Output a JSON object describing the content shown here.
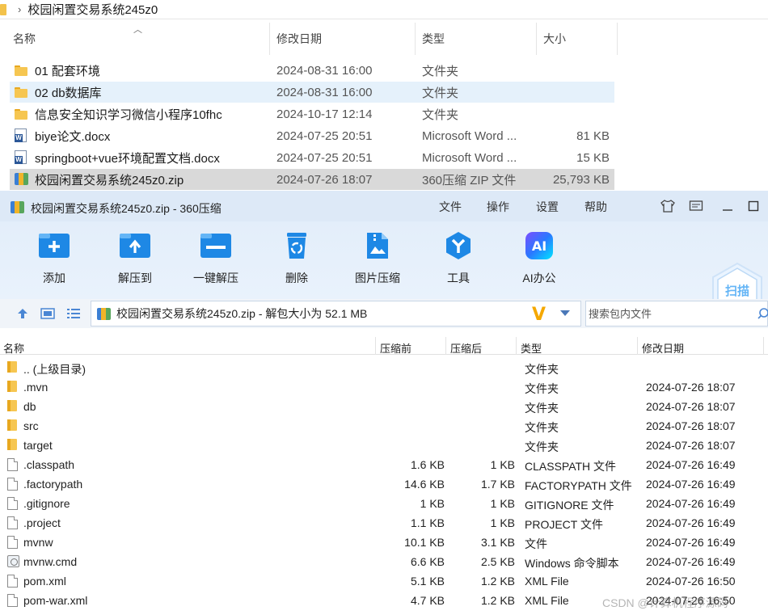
{
  "explorer": {
    "breadcrumb": "校园闲置交易系统245z0",
    "columns": {
      "name": "名称",
      "date": "修改日期",
      "type": "类型",
      "size": "大小"
    },
    "rows": [
      {
        "name": "01 配套环境",
        "date": "2024-08-31 16:00",
        "type": "文件夹",
        "size": "",
        "icon": "folder-icon"
      },
      {
        "name": "02 db数据库",
        "date": "2024-08-31 16:00",
        "type": "文件夹",
        "size": "",
        "icon": "folder-icon"
      },
      {
        "name": "信息安全知识学习微信小程序10fhc",
        "date": "2024-10-17 12:14",
        "type": "文件夹",
        "size": "",
        "icon": "folder-icon"
      },
      {
        "name": "biye论文.docx",
        "date": "2024-07-25 20:51",
        "type": "Microsoft Word ...",
        "size": "81 KB",
        "icon": "word-document-icon"
      },
      {
        "name": "springboot+vue环境配置文档.docx",
        "date": "2024-07-25 20:51",
        "type": "Microsoft Word ...",
        "size": "15 KB",
        "icon": "word-document-icon"
      },
      {
        "name": "校园闲置交易系统245z0.zip",
        "date": "2024-07-26 18:07",
        "type": "360压缩 ZIP 文件",
        "size": "25,793 KB",
        "icon": "zip-archive-icon"
      }
    ]
  },
  "zip_window": {
    "title": "校园闲置交易系统245z0.zip - 360压缩",
    "menu": [
      "文件",
      "操作",
      "设置",
      "帮助"
    ],
    "toolbar": [
      {
        "label": "添加",
        "icon": "add-icon"
      },
      {
        "label": "解压到",
        "icon": "extract-to-icon"
      },
      {
        "label": "一键解压",
        "icon": "one-click-extract-icon"
      },
      {
        "label": "删除",
        "icon": "recycle-bin-icon"
      },
      {
        "label": "图片压缩",
        "icon": "image-compress-icon"
      },
      {
        "label": "工具",
        "icon": "tools-icon"
      },
      {
        "label": "AI办公",
        "icon": "ai-office-icon"
      }
    ],
    "scan_label": "扫描",
    "ai_badge": "AI",
    "address": "校园闲置交易系统245z0.zip - 解包大小为 52.1 MB",
    "search_placeholder": "搜索包内文件",
    "list_columns": {
      "name": "名称",
      "before": "压缩前",
      "after": "压缩后",
      "type": "类型",
      "date": "修改日期"
    },
    "rows": [
      {
        "name": ".. (上级目录)",
        "before": "",
        "after": "",
        "type": "文件夹",
        "date": "",
        "icon": "folder-icon"
      },
      {
        "name": ".mvn",
        "before": "",
        "after": "",
        "type": "文件夹",
        "date": "2024-07-26 18:07",
        "icon": "folder-icon"
      },
      {
        "name": "db",
        "before": "",
        "after": "",
        "type": "文件夹",
        "date": "2024-07-26 18:07",
        "icon": "folder-icon"
      },
      {
        "name": "src",
        "before": "",
        "after": "",
        "type": "文件夹",
        "date": "2024-07-26 18:07",
        "icon": "folder-icon"
      },
      {
        "name": "target",
        "before": "",
        "after": "",
        "type": "文件夹",
        "date": "2024-07-26 18:07",
        "icon": "folder-icon"
      },
      {
        "name": ".classpath",
        "before": "1.6 KB",
        "after": "1 KB",
        "type": "CLASSPATH 文件",
        "date": "2024-07-26 16:49",
        "icon": "file-icon"
      },
      {
        "name": ".factorypath",
        "before": "14.6 KB",
        "after": "1.7 KB",
        "type": "FACTORYPATH 文件",
        "date": "2024-07-26 16:49",
        "icon": "file-icon"
      },
      {
        "name": ".gitignore",
        "before": "1 KB",
        "after": "1 KB",
        "type": "GITIGNORE 文件",
        "date": "2024-07-26 16:49",
        "icon": "file-icon"
      },
      {
        "name": ".project",
        "before": "1.1 KB",
        "after": "1 KB",
        "type": "PROJECT 文件",
        "date": "2024-07-26 16:49",
        "icon": "file-icon"
      },
      {
        "name": "mvnw",
        "before": "10.1 KB",
        "after": "3.1 KB",
        "type": "文件",
        "date": "2024-07-26 16:49",
        "icon": "file-icon"
      },
      {
        "name": "mvnw.cmd",
        "before": "6.6 KB",
        "after": "2.5 KB",
        "type": "Windows 命令脚本",
        "date": "2024-07-26 16:49",
        "icon": "cmd-script-icon"
      },
      {
        "name": "pom.xml",
        "before": "5.1 KB",
        "after": "1.2 KB",
        "type": "XML File",
        "date": "2024-07-26 16:50",
        "icon": "file-icon"
      },
      {
        "name": "pom-war.xml",
        "before": "4.7 KB",
        "after": "1.2 KB",
        "type": "XML File",
        "date": "2024-07-26 16:50",
        "icon": "file-icon"
      }
    ]
  },
  "watermark": "CSDN @计算机程序源码",
  "colors": {
    "accent": "#1e88e5",
    "title_bar": "#dde9f7",
    "selected_row": "#d9d9d9",
    "hover_row": "#e5f1fb",
    "folder": "#f6c651"
  }
}
